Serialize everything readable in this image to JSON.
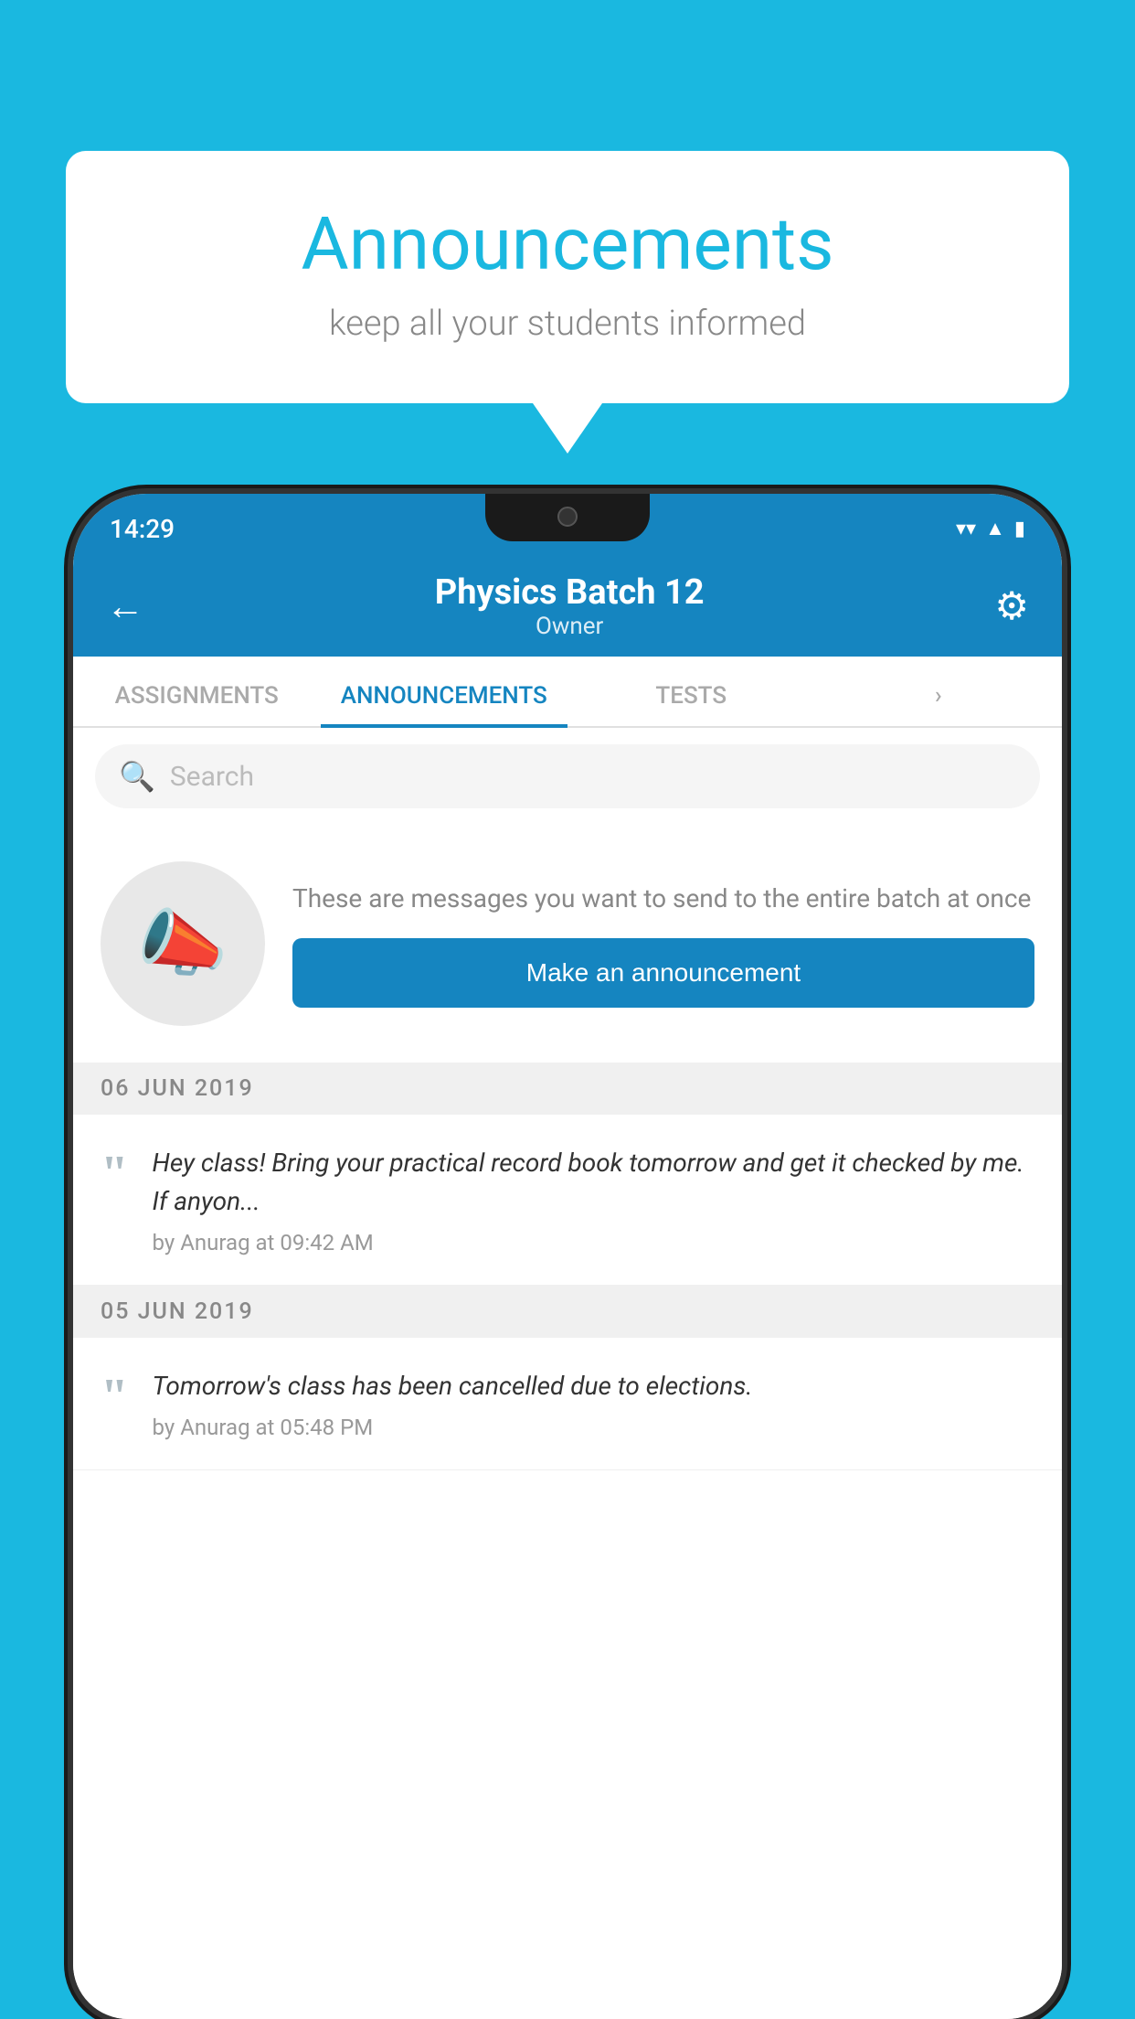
{
  "background_color": "#1ab8e0",
  "speech_bubble": {
    "title": "Announcements",
    "subtitle": "keep all your students informed",
    "title_color": "#1ab8e0",
    "subtitle_color": "#888888"
  },
  "status_bar": {
    "time": "14:29",
    "wifi_icon": "▼",
    "signal_icon": "▲",
    "battery_icon": "▮"
  },
  "app_header": {
    "back_label": "←",
    "batch_name": "Physics Batch 12",
    "owner_label": "Owner",
    "settings_icon": "⚙"
  },
  "tabs": [
    {
      "label": "ASSIGNMENTS",
      "active": false
    },
    {
      "label": "ANNOUNCEMENTS",
      "active": true
    },
    {
      "label": "TESTS",
      "active": false
    },
    {
      "label": "",
      "active": false
    }
  ],
  "search": {
    "placeholder": "Search"
  },
  "promo": {
    "description_text": "These are messages you want to send to the entire batch at once",
    "button_label": "Make an announcement"
  },
  "announcements": [
    {
      "date": "06  JUN  2019",
      "items": [
        {
          "text": "Hey class! Bring your practical record book tomorrow and get it checked by me. If anyon...",
          "meta": "by Anurag at 09:42 AM"
        }
      ]
    },
    {
      "date": "05  JUN  2019",
      "items": [
        {
          "text": "Tomorrow's class has been cancelled due to elections.",
          "meta": "by Anurag at 05:48 PM"
        }
      ]
    }
  ]
}
